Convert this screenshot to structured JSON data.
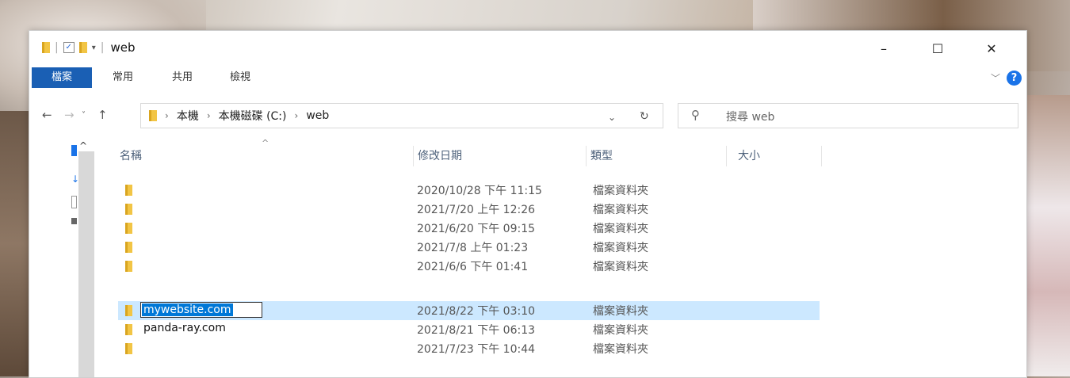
{
  "window": {
    "title": "web",
    "controls": {
      "minimize": "–",
      "maximize": "☐",
      "close": "✕"
    }
  },
  "ribbon": {
    "tabs": [
      "檔案",
      "常用",
      "共用",
      "檢視"
    ],
    "help": "?"
  },
  "address": {
    "crumbs": [
      "本機",
      "本機磁碟 (C:)",
      "web"
    ],
    "search_placeholder": "搜尋 web"
  },
  "columns": {
    "name": "名稱",
    "modified": "修改日期",
    "type": "類型",
    "size": "大小"
  },
  "files": [
    {
      "name": "",
      "date": "2020/10/28 下午 11:15",
      "type": "檔案資料夾"
    },
    {
      "name": "",
      "date": "2021/7/20 上午 12:26",
      "type": "檔案資料夾"
    },
    {
      "name": "",
      "date": "2021/6/20 下午 09:15",
      "type": "檔案資料夾"
    },
    {
      "name": "",
      "date": "2021/7/8 上午 01:23",
      "type": "檔案資料夾"
    },
    {
      "name": "",
      "date": "2021/6/6 下午 01:41",
      "type": "檔案資料夾"
    },
    {
      "name": "mywebsite.com",
      "date": "2021/8/22 下午 03:10",
      "type": "檔案資料夾",
      "renaming": true
    },
    {
      "name": "panda-ray.com",
      "date": "2021/8/21 下午 06:13",
      "type": "檔案資料夾"
    },
    {
      "name": "",
      "date": "2021/7/23 下午 10:44",
      "type": "檔案資料夾"
    }
  ],
  "colors": {
    "accent": "#1a5fb4",
    "selection": "#cce8ff",
    "folder": "#f2c545"
  }
}
